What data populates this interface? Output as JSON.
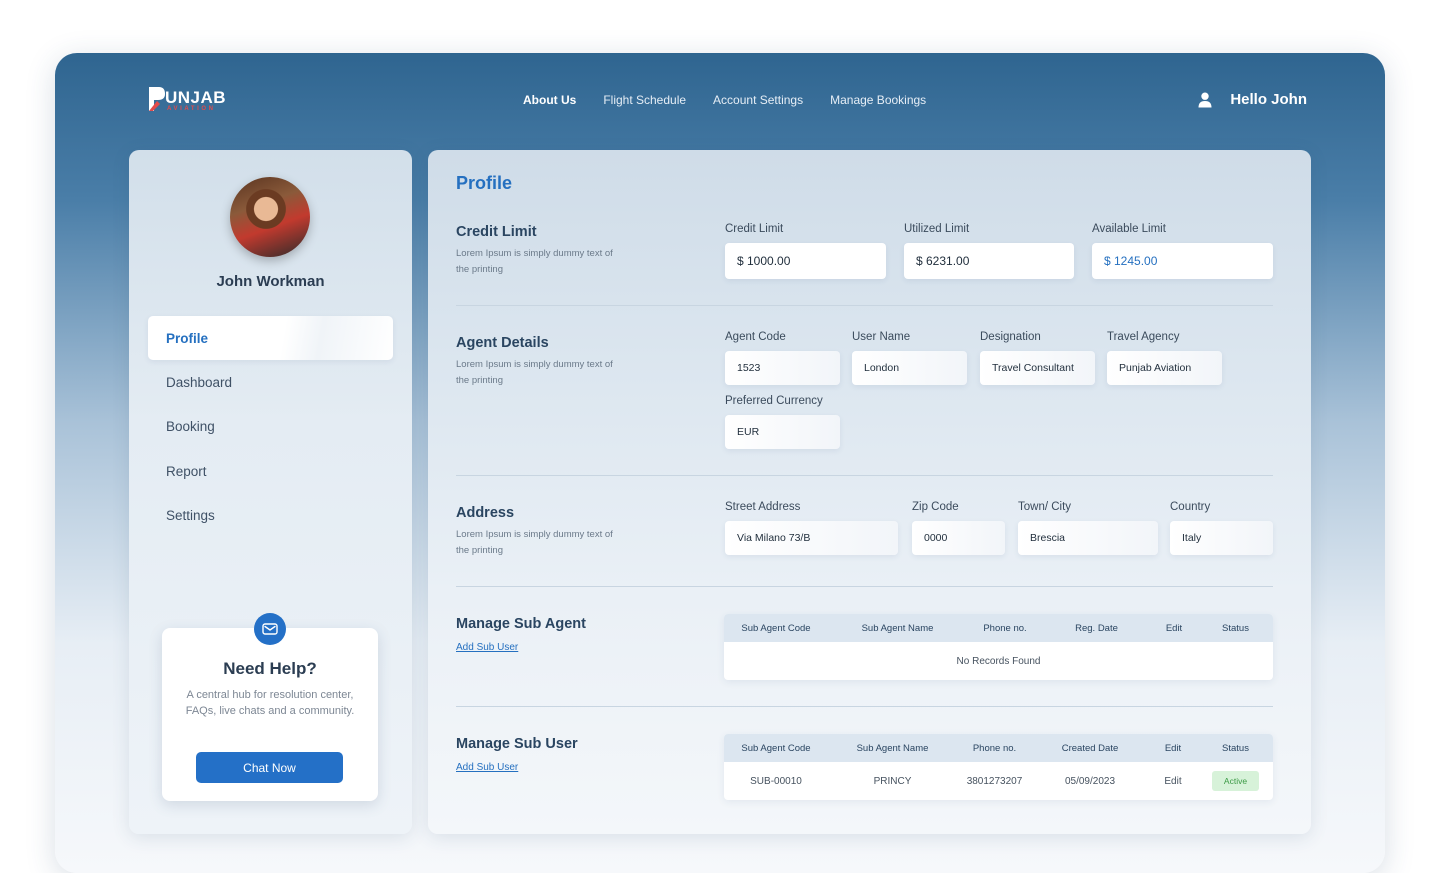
{
  "brand": {
    "name": "UNJAB",
    "tagline": "AVIATION",
    "colors": {
      "primary": "#2470c7",
      "accent": "#e14b4b"
    }
  },
  "nav": {
    "items": [
      "About Us",
      "Flight Schedule",
      "Account Settings",
      "Manage Bookings"
    ],
    "active": "About Us"
  },
  "user": {
    "greeting": "Hello John",
    "icon": "user-icon"
  },
  "sidebar": {
    "name": "John Workman",
    "items": [
      {
        "label": "Profile",
        "active": true
      },
      {
        "label": "Dashboard"
      },
      {
        "label": "Booking"
      },
      {
        "label": "Report"
      },
      {
        "label": "Settings"
      }
    ],
    "help": {
      "icon": "mail-icon",
      "title": "Need Help?",
      "text": "A central hub for resolution center, FAQs, live chats and a community.",
      "button": "Chat Now"
    }
  },
  "main": {
    "title": "Profile",
    "credit": {
      "title": "Credit Limit",
      "desc": "Lorem Ipsum is simply dummy text of the printing",
      "fields": [
        {
          "label": "Credit Limit",
          "value": "$ 1000.00"
        },
        {
          "label": "Utilized Limit",
          "value": "$ 6231.00"
        },
        {
          "label": "Available Limit",
          "value": "$ 1245.00"
        }
      ]
    },
    "agent": {
      "title": "Agent Details",
      "desc": "Lorem Ipsum is simply dummy text of the printing",
      "fields": [
        {
          "label": "Agent Code",
          "value": "1523"
        },
        {
          "label": "User Name",
          "value": "London"
        },
        {
          "label": "Designation",
          "value": "Travel Consultant"
        },
        {
          "label": "Travel Agency",
          "value": "Punjab Aviation"
        },
        {
          "label": "Preferred Currency",
          "value": "EUR"
        }
      ]
    },
    "address": {
      "title": "Address",
      "desc": "Lorem Ipsum is simply dummy text of the printing",
      "fields": [
        {
          "label": "Street Address",
          "value": "Via Milano 73/B"
        },
        {
          "label": "Zip Code",
          "value": "0000"
        },
        {
          "label": "Town/ City",
          "value": "Brescia"
        },
        {
          "label": "Country",
          "value": "Italy"
        }
      ]
    },
    "subagent": {
      "title": "Manage Sub Agent",
      "link": "Add Sub User",
      "columns": [
        "Sub Agent Code",
        "Sub Agent Name",
        "Phone no.",
        "Reg. Date",
        "Edit",
        "Status"
      ],
      "empty": "No Records Found"
    },
    "subuser": {
      "title": "Manage Sub User",
      "link": "Add Sub User",
      "columns": [
        "Sub Agent Code",
        "Sub Agent Name",
        "Phone no.",
        "Created Date",
        "Edit",
        "Status"
      ],
      "rows": [
        {
          "code": "SUB-00010",
          "name": "PRINCY",
          "phone": "3801273207",
          "date": "05/09/2023",
          "edit": "Edit",
          "status": "Active"
        }
      ]
    }
  }
}
